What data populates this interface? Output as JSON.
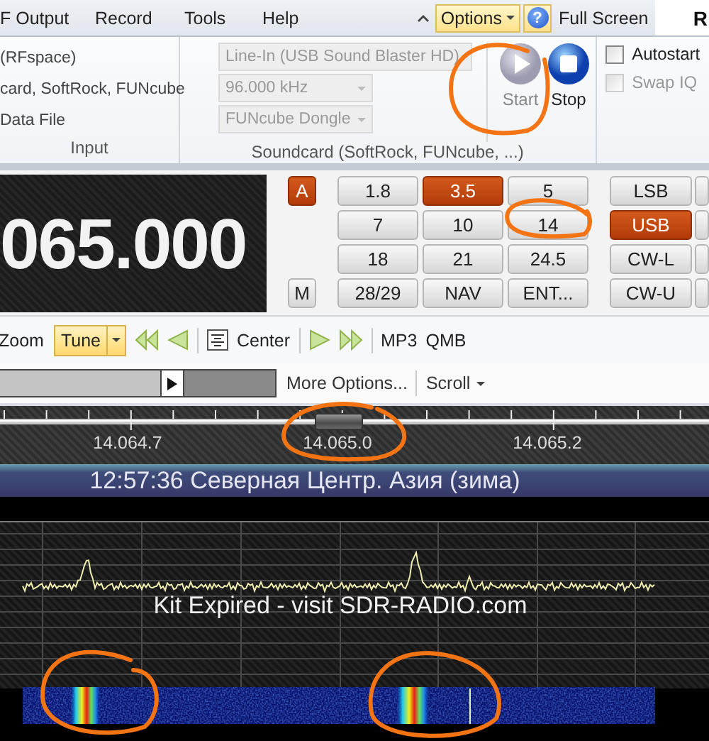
{
  "menu": [
    {
      "label": "F Output"
    },
    {
      "label": "Record"
    },
    {
      "label": "Tools"
    },
    {
      "label": "Help"
    }
  ],
  "quick_access": {
    "options": "Options",
    "help": "?",
    "full_screen": "Full Screen",
    "logo": "R"
  },
  "ribbon": {
    "input_group": {
      "items": [
        "(RFspace)",
        "card, SoftRock, FUNcube",
        "Data File"
      ],
      "label": "Input"
    },
    "soundcard_group": {
      "device": "Line-In (USB Sound Blaster HD)",
      "rate": "96.000 kHz",
      "hardware": "FUNcube Dongle",
      "disabled": true,
      "start": {
        "label": "Start",
        "disabled": true
      },
      "stop": {
        "label": "Stop",
        "disabled": false
      },
      "label": "Soundcard (SoftRock, FUNcube, ...)"
    },
    "options": [
      {
        "label": "Autostart",
        "checked": false,
        "disabled": false
      },
      {
        "label": "Swap IQ",
        "checked": false,
        "disabled": true
      }
    ]
  },
  "frequency": "065.000",
  "vfo_buttons": [
    {
      "label": "A",
      "selected": true
    },
    {
      "label": "M",
      "selected": false
    }
  ],
  "bands": [
    {
      "label": "1.8",
      "selected": false
    },
    {
      "label": "3.5",
      "selected": true
    },
    {
      "label": "5",
      "selected": false
    },
    {
      "label": "7",
      "selected": false
    },
    {
      "label": "10",
      "selected": false
    },
    {
      "label": "14",
      "selected": false
    },
    {
      "label": "18",
      "selected": false
    },
    {
      "label": "21",
      "selected": false
    },
    {
      "label": "24.5",
      "selected": false
    },
    {
      "label": "28/29",
      "selected": false
    },
    {
      "label": "NAV",
      "selected": false
    },
    {
      "label": "ENT...",
      "selected": false
    }
  ],
  "modes": [
    {
      "label": "LSB",
      "selected": false
    },
    {
      "label": "USB",
      "selected": true
    },
    {
      "label": "CW-L",
      "selected": false
    },
    {
      "label": "CW-U",
      "selected": false
    }
  ],
  "toolbar": {
    "zoom": "Zoom",
    "tune": "Tune",
    "center": "Center",
    "mp3": "MP3",
    "qmb": "QMB"
  },
  "options_bar": {
    "more": "More Options...",
    "scroll": "Scroll"
  },
  "scale": [
    "14.064.7",
    "14.065.0",
    "14.065.2"
  ],
  "status": "12:57:36 Северная Центр. Азия (зима)",
  "spectrum": {
    "notice": "Kit Expired - visit SDR-RADIO.com"
  },
  "annotations": [
    {
      "kind": "circle"
    },
    {
      "kind": "circle"
    },
    {
      "kind": "circle"
    },
    {
      "kind": "circle"
    },
    {
      "kind": "circle"
    }
  ]
}
